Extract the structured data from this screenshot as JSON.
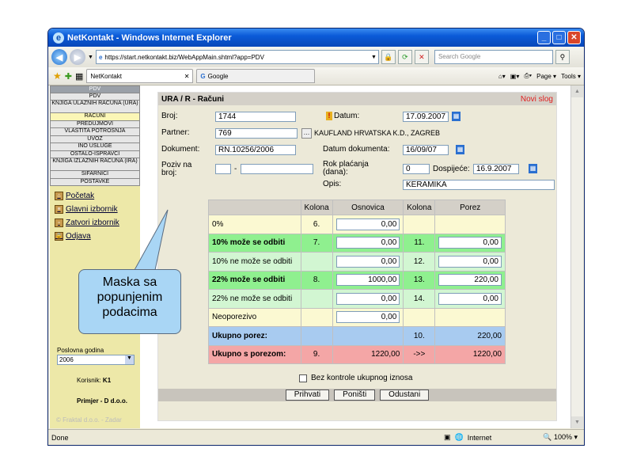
{
  "window": {
    "title": "NetKontakt - Windows Internet Explorer"
  },
  "browser": {
    "url": "https://start.netkontakt.biz/WebAppMain.shtml?app=PDV",
    "search_placeholder": "Search Google",
    "tabs": [
      {
        "label": "NetKontakt"
      },
      {
        "label": "Google"
      }
    ],
    "page_label": "Page",
    "tools_label": "Tools",
    "status": "Done",
    "zone": "Internet",
    "zoom": "100%"
  },
  "sidebar": {
    "menu": [
      {
        "label": "PDV",
        "style": "top"
      },
      {
        "label": "PDV"
      },
      {
        "label": "KNJIGA ULAZNIH RAČUNA (URA)",
        "style": "twol"
      },
      {
        "label": "RAČUNI",
        "style": "sel"
      },
      {
        "label": "PREDUJMOVI"
      },
      {
        "label": "VLASTITA POTROŠNJA"
      },
      {
        "label": "UVOZ"
      },
      {
        "label": "INO USLUGE"
      },
      {
        "label": "OSTALO-ISPRAVCI"
      },
      {
        "label": "KNJIGA IZLAZNIH RAČUNA (IRA)",
        "style": "twol"
      },
      {
        "label": "ŠIFARNICI"
      },
      {
        "label": "POSTAVKE"
      }
    ],
    "links": {
      "home": "Početak",
      "main_menu": "Glavni izbornik",
      "close_menu": "Zatvori izbornik",
      "logout": "Odjava"
    },
    "year_label": "Poslovna godina",
    "year_value": "2006",
    "user_label": "Korisnik:",
    "user_value": "K1",
    "company": "Primjer - D d.o.o.",
    "copyright": "© Fraktal d.o.o. - Zadar"
  },
  "form": {
    "title": "URA / R - Računi",
    "new_record": "Novi slog",
    "broj_label": "Broj:",
    "broj": "1744",
    "datum_label": "Datum:",
    "datum": "17.09.2007",
    "partner_label": "Partner:",
    "partner_code": "769",
    "partner_name": "KAUFLAND HRVATSKA K.D., ZAGREB",
    "dokument_label": "Dokument:",
    "dokument": "RN.10256/2006",
    "datum_dok_label": "Datum dokumenta:",
    "datum_dok": "16/09/07",
    "poziv_label1": "Poziv na",
    "poziv_label2": "broj:",
    "poziv_sep": "-",
    "rok_label1": "Rok plaćanja",
    "rok_label2": "(dana):",
    "rok": "0",
    "dospijece_label": "Dospijeće:",
    "dospijece": "16.9.2007",
    "opis_label": "Opis:",
    "opis": "KERAMIKA",
    "table": {
      "headers": [
        "",
        "Kolona",
        "Osnovica",
        "Kolona",
        "Porez"
      ],
      "rows": [
        {
          "label": "0%",
          "col1": "6.",
          "base": "0,00",
          "col2": "",
          "tax": ""
        },
        {
          "label": "10% može se odbiti",
          "col1": "7.",
          "base": "0,00",
          "col2": "11.",
          "tax": "0,00"
        },
        {
          "label": "10% ne može se odbiti",
          "col1": "",
          "base": "0,00",
          "col2": "12.",
          "tax": "0,00"
        },
        {
          "label": "22% može se odbiti",
          "col1": "8.",
          "base": "1000,00",
          "col2": "13.",
          "tax": "220,00"
        },
        {
          "label": "22% ne može se odbiti",
          "col1": "",
          "base": "0,00",
          "col2": "14.",
          "tax": "0,00"
        },
        {
          "label": "Neoporezivo",
          "col1": "",
          "base": "0,00",
          "col2": "",
          "tax": ""
        },
        {
          "label": "Ukupno porez:",
          "col1": "",
          "base": "",
          "col2": "10.",
          "tax": "220,00"
        },
        {
          "label": "Ukupno s porezom:",
          "col1": "9.",
          "base": "1220,00",
          "col2": "->>",
          "tax": "1220,00"
        }
      ]
    },
    "checkbox_label": "Bez kontrole ukupnog iznosa",
    "buttons": {
      "accept": "Prihvati",
      "reset": "Poništi",
      "cancel": "Odustani"
    }
  },
  "callout": {
    "line1": "Maska sa",
    "line2": "popunjenim",
    "line3": "podacima"
  }
}
